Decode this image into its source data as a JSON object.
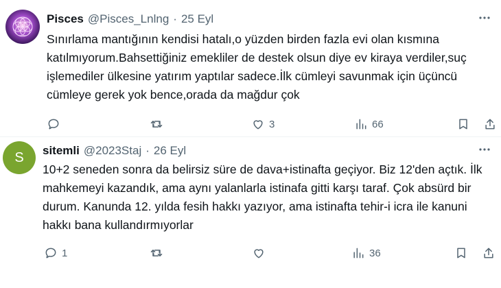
{
  "tweets": [
    {
      "name": "Pisces",
      "handle": "@Pisces_Lnlng",
      "separator": "·",
      "date": "25 Eyl",
      "avatar_icon": "flower-of-life-icon",
      "text": "Sınırlama mantığının kendisi hatalı,o yüzden birden fazla evi olan kısmına katılmıyorum.Bahsettiğiniz emekliler de destek olsun diye ev kiraya verdiler,suç işlemediler ülkesine yatırım yaptılar sadece.İlk cümleyi savunmak için üçüncü cümleye gerek yok bence,orada da mağdur çok",
      "replies": "",
      "retweets": "",
      "likes": "3",
      "views": "66"
    },
    {
      "name": "sitemli",
      "handle": "@2023Staj",
      "separator": "·",
      "date": "26 Eyl",
      "avatar_letter": "S",
      "avatar_color": "#7aa52f",
      "text": "10+2 seneden sonra da belirsiz süre de dava+istinafta geçiyor. Biz 12'den açtık. İlk mahkemeyi kazandık, ama aynı yalanlarla istinafa gitti karşı taraf. Çok absürd bir durum. Kanunda 12. yılda fesih hakkı yazıyor, ama istinafta tehir-i icra ile kanuni hakkı bana kullandırmıyorlar",
      "replies": "1",
      "retweets": "",
      "likes": "",
      "views": "36"
    }
  ],
  "more_icon": "more-horizontal-icon",
  "action_icons": [
    "reply-icon",
    "retweet-icon",
    "like-icon",
    "views-icon",
    "bookmark-icon",
    "share-icon"
  ]
}
